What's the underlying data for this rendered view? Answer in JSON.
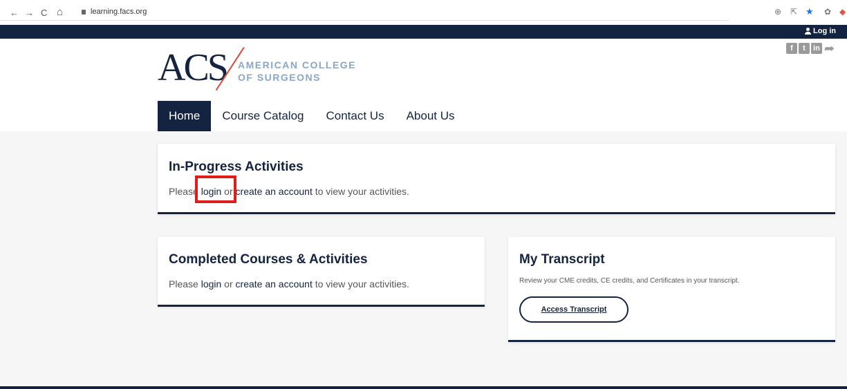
{
  "browser": {
    "back": "←",
    "forward": "→",
    "reload": "C",
    "home": "⌂",
    "url": "learning.facs.org"
  },
  "topbar": {
    "login_label": "Log in"
  },
  "social": {
    "facebook": "f",
    "twitter": "t",
    "linkedin": "in",
    "share": "➦"
  },
  "logo": {
    "acs": "ACS",
    "line1": "AMERICAN COLLEGE",
    "line2": "OF SURGEONS"
  },
  "nav": {
    "items": [
      {
        "label": "Home"
      },
      {
        "label": "Course Catalog"
      },
      {
        "label": "Contact Us"
      },
      {
        "label": "About Us"
      }
    ]
  },
  "in_progress": {
    "title": "In-Progress Activities",
    "text_prefix": "Please ",
    "login": "login",
    "text_mid": " or ",
    "create": "create an account",
    "text_suffix": " to view your activities."
  },
  "completed": {
    "title": "Completed Courses & Activities",
    "text_prefix": "Please ",
    "login": "login",
    "text_mid": " or ",
    "create": "create an account",
    "text_suffix": " to view your activities."
  },
  "transcript": {
    "title": "My Transcript",
    "description": "Review your CME credits, CE credits, and Certificates in your transcript.",
    "button_label": "Access Transcript"
  },
  "colors": {
    "navy": "#14233f",
    "highlight": "#e21b1b",
    "logo_accent": "#d8493a",
    "logo_text": "#8aa6c4"
  }
}
